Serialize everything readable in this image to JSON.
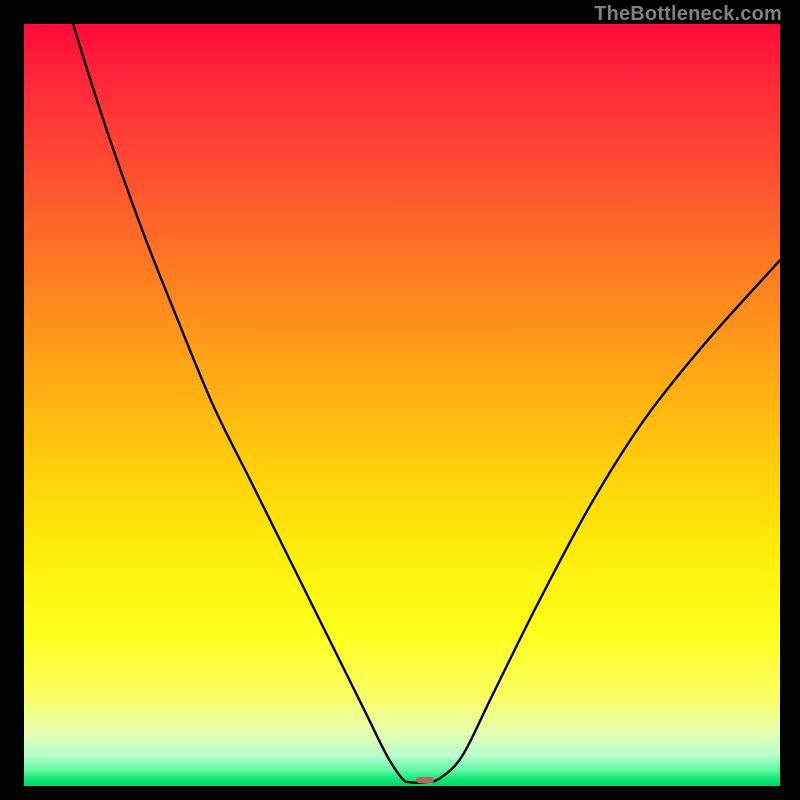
{
  "watermark": "TheBottleneck.com",
  "chart_data": {
    "type": "line",
    "title": "",
    "xlabel": "",
    "ylabel": "",
    "xlim": [
      0,
      100
    ],
    "ylim": [
      0,
      100
    ],
    "grid": false,
    "gradient_stops": [
      {
        "pct": 0,
        "color": "#ff0a3a"
      },
      {
        "pct": 8,
        "color": "#ff2a3a"
      },
      {
        "pct": 20,
        "color": "#ff5030"
      },
      {
        "pct": 32,
        "color": "#ff7a22"
      },
      {
        "pct": 45,
        "color": "#ffa516"
      },
      {
        "pct": 58,
        "color": "#ffcf0a"
      },
      {
        "pct": 70,
        "color": "#ffef0a"
      },
      {
        "pct": 80,
        "color": "#ffff1e"
      },
      {
        "pct": 88,
        "color": "#fbff60"
      },
      {
        "pct": 93,
        "color": "#e6ffb0"
      },
      {
        "pct": 96,
        "color": "#b8ffcf"
      },
      {
        "pct": 98,
        "color": "#5cf7a0"
      },
      {
        "pct": 99,
        "color": "#15e879"
      },
      {
        "pct": 100,
        "color": "#00d864"
      }
    ],
    "series": [
      {
        "name": "bottleneck-curve",
        "color": "#000000",
        "points": [
          {
            "x": 6.5,
            "y": 100.0
          },
          {
            "x": 9.0,
            "y": 92.0
          },
          {
            "x": 12.0,
            "y": 83.0
          },
          {
            "x": 16.0,
            "y": 72.0
          },
          {
            "x": 20.0,
            "y": 62.0
          },
          {
            "x": 25.0,
            "y": 50.0
          },
          {
            "x": 30.0,
            "y": 40.0
          },
          {
            "x": 35.0,
            "y": 30.0
          },
          {
            "x": 40.0,
            "y": 20.0
          },
          {
            "x": 45.0,
            "y": 10.0
          },
          {
            "x": 48.0,
            "y": 4.0
          },
          {
            "x": 50.0,
            "y": 1.0
          },
          {
            "x": 51.0,
            "y": 0.5
          },
          {
            "x": 53.0,
            "y": 0.5
          },
          {
            "x": 55.0,
            "y": 1.0
          },
          {
            "x": 58.0,
            "y": 4.0
          },
          {
            "x": 62.0,
            "y": 12.0
          },
          {
            "x": 68.0,
            "y": 24.0
          },
          {
            "x": 75.0,
            "y": 37.0
          },
          {
            "x": 82.0,
            "y": 48.0
          },
          {
            "x": 90.0,
            "y": 58.0
          },
          {
            "x": 100.0,
            "y": 69.0
          }
        ]
      }
    ],
    "markers": [
      {
        "name": "optimum-marker",
        "x": 53.0,
        "y": 0.8,
        "color": "#b7655d"
      }
    ]
  }
}
